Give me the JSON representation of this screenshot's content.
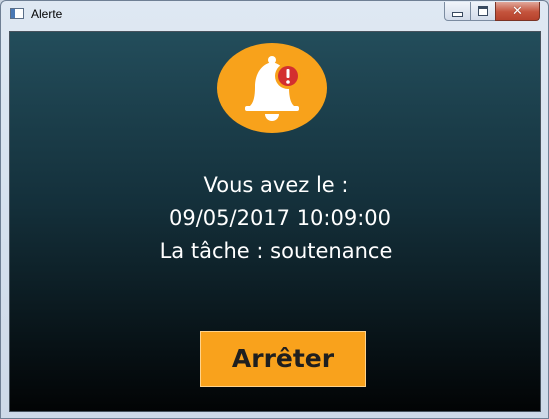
{
  "window": {
    "title": "Alerte",
    "controls": {
      "minimize": "minimize-icon",
      "maximize": "maximize-icon",
      "close": "close-icon",
      "close_glyph": "✕"
    }
  },
  "alert": {
    "icon": "bell-alert-icon",
    "line1": "Vous avez le :",
    "line2": "09/05/2017 10:09:00",
    "line3": "La tâche : soutenance"
  },
  "actions": {
    "stop_label": "Arrêter"
  },
  "colors": {
    "accent": "#f8a21b",
    "warning_badge": "#d32f2f",
    "background_top": "#234d5b",
    "background_bottom": "#020405"
  }
}
